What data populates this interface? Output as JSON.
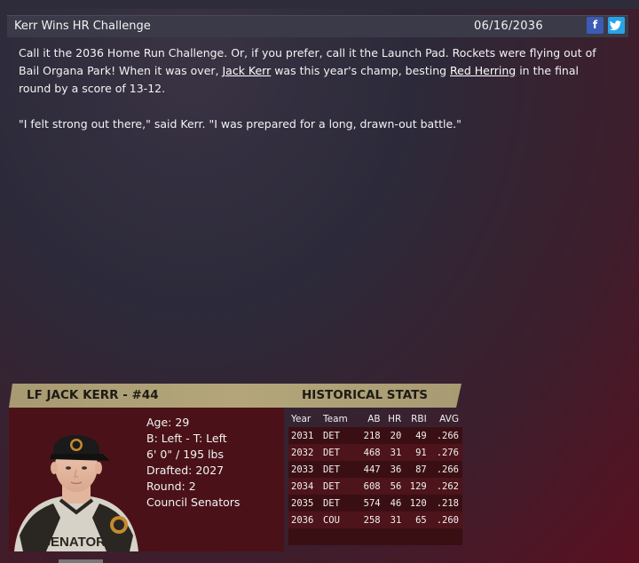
{
  "news": {
    "headline": "Kerr Wins HR Challenge",
    "date": "06/16/2036",
    "social": {
      "facebook_label": "f",
      "twitter_label": "t"
    },
    "p1_a": "Call it the 2036 Home Run Challenge. Or, if you prefer, call it the Launch Pad. Rockets were flying out of Bail Organa Park! When it was over, ",
    "p1_link1": "Jack Kerr",
    "p1_b": " was this year's champ, besting ",
    "p1_link2": "Red Herring",
    "p1_c": " in the final round by a score of 13-12.",
    "p2": "\"I felt strong out there,\" said Kerr. \"I was prepared for a long, drawn-out battle.\""
  },
  "player": {
    "title": "LF JACK KERR - #44",
    "age": "Age: 29",
    "bats_throws": "B: Left - T: Left",
    "size": "6' 0\" / 195 lbs",
    "drafted": "Drafted: 2027",
    "round": "Round: 2",
    "team": "Council Senators",
    "jersey_text": "SENATORS"
  },
  "historical": {
    "title": "HISTORICAL STATS",
    "headers": [
      "Year",
      "Team",
      "AB",
      "HR",
      "RBI",
      "AVG"
    ],
    "rows": [
      [
        "2031",
        "DET",
        "218",
        "20",
        "49",
        ".266"
      ],
      [
        "2032",
        "DET",
        "468",
        "31",
        "91",
        ".276"
      ],
      [
        "2033",
        "DET",
        "447",
        "36",
        "87",
        ".266"
      ],
      [
        "2034",
        "DET",
        "608",
        "56",
        "129",
        ".262"
      ],
      [
        "2035",
        "DET",
        "574",
        "46",
        "120",
        ".218"
      ],
      [
        "2036",
        "COU",
        "258",
        "31",
        "65",
        ".260"
      ]
    ]
  }
}
